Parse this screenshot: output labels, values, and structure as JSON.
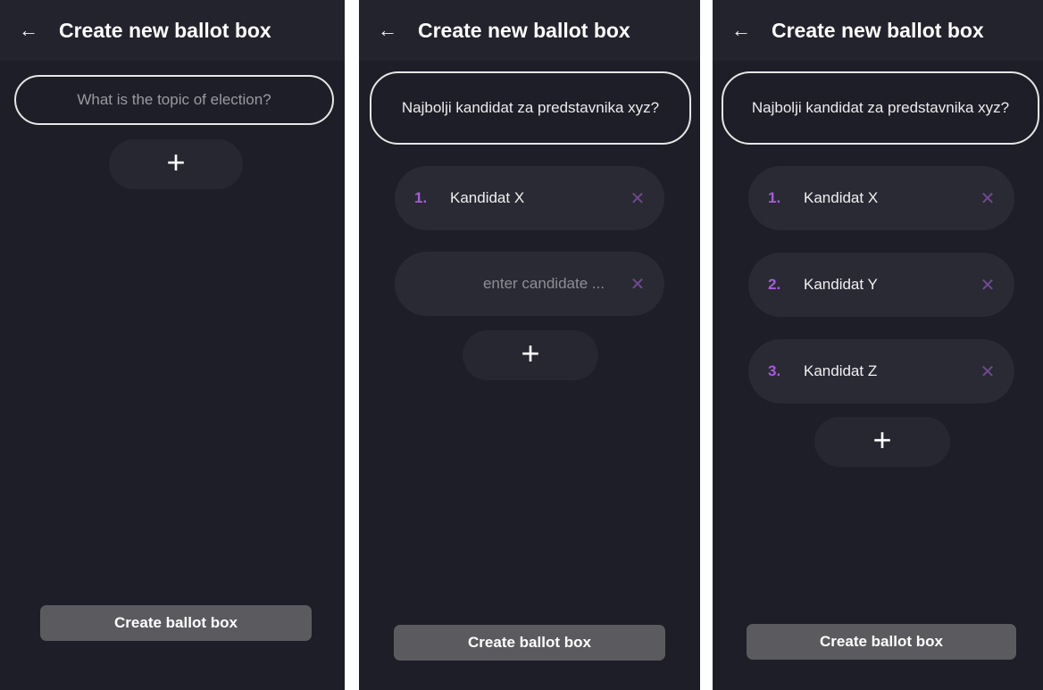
{
  "common": {
    "title": "Create new ballot box",
    "back_icon": "←",
    "create_label": "Create ballot box",
    "add_symbol": "+",
    "remove_symbol": "✕"
  },
  "screen1": {
    "topic_placeholder": "What is the topic of election?"
  },
  "screen2": {
    "topic_value": "Najbolji kandidat za predstavnika xyz?",
    "candidates": [
      {
        "number": "1.",
        "name": "Kandidat X"
      },
      {
        "number": "",
        "placeholder": "enter candidate ..."
      }
    ]
  },
  "screen3": {
    "topic_value": "Najbolji kandidat za predstavnika xyz?",
    "candidates": [
      {
        "number": "1.",
        "name": "Kandidat X"
      },
      {
        "number": "2.",
        "name": "Kandidat Y"
      },
      {
        "number": "3.",
        "name": "Kandidat Z"
      }
    ]
  },
  "colors": {
    "background": "#1e1e28",
    "appbar": "#23232d",
    "accent_number": "#a65cd6",
    "remove_icon": "#6f4a8f",
    "button": "#5b5b5f"
  }
}
